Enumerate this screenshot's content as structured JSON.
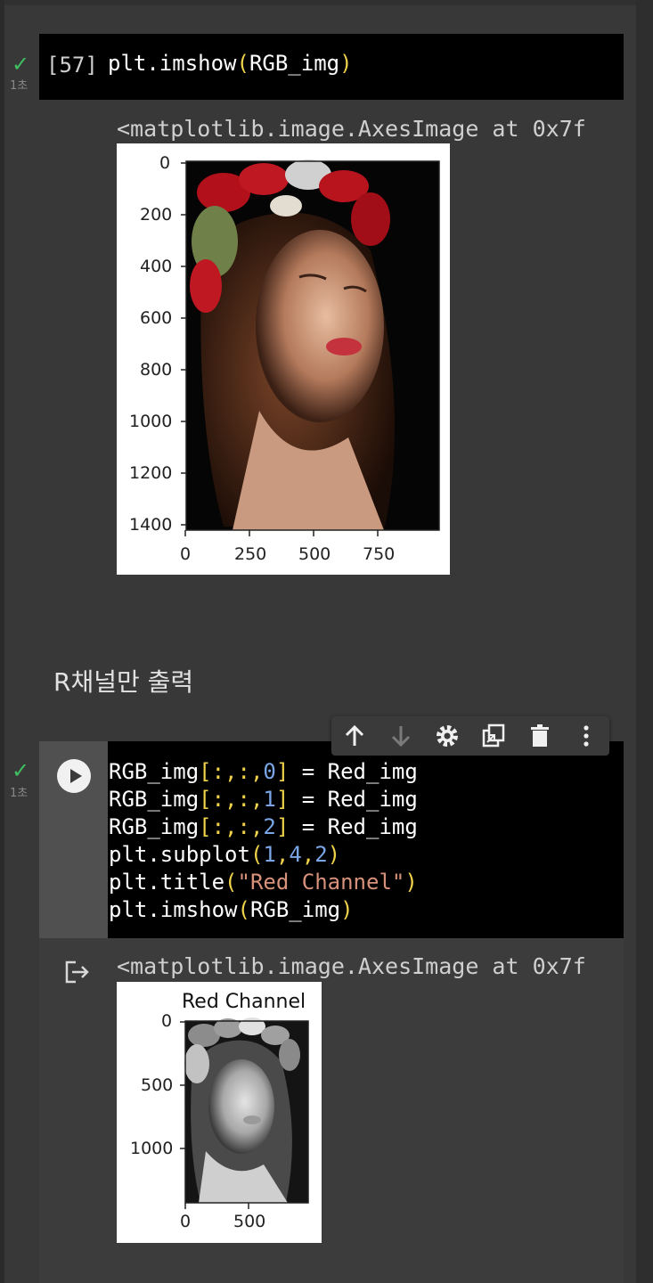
{
  "cell1": {
    "exec_count": "[57]",
    "status_time": "1초",
    "code": "plt.imshow(RGB_img)",
    "output_text": "<matplotlib.image.AxesImage at 0x7f",
    "plot": {
      "y_ticks": [
        "0",
        "200",
        "400",
        "600",
        "800",
        "1000",
        "1200",
        "1400"
      ],
      "x_ticks": [
        "0",
        "250",
        "500",
        "750"
      ]
    }
  },
  "markdown": {
    "text": "R채널만 출력"
  },
  "toolbar": {
    "icons": [
      "arrow-up-icon",
      "arrow-down-icon",
      "gear-icon",
      "mirror-cell-icon",
      "trash-icon",
      "more-vert-icon"
    ]
  },
  "cell2": {
    "status_time": "1초",
    "code_lines": [
      {
        "a": "RGB_img",
        "b": "[:,:,",
        "c": "0",
        "d": "]",
        "e": " = Red_img"
      },
      {
        "a": "RGB_img",
        "b": "[:,:,",
        "c": "1",
        "d": "]",
        "e": " = Red_img"
      },
      {
        "a": "RGB_img",
        "b": "[:,:,",
        "c": "2",
        "d": "]",
        "e": " = Red_img"
      }
    ],
    "line4": {
      "fn": "plt.subplot",
      "open": "(",
      "n1": "1",
      "c1": ",",
      "n2": "4",
      "c2": ",",
      "n3": "2",
      "close": ")"
    },
    "line5": {
      "fn": "plt.title",
      "open": "(",
      "str": "\"Red Channel\"",
      "close": ")"
    },
    "line6": {
      "fn": "plt.imshow",
      "open": "(",
      "arg": "RGB_img",
      "close": ")"
    },
    "output_text": "<matplotlib.image.AxesImage at 0x7f",
    "plot": {
      "title": "Red Channel",
      "y_ticks": [
        "0",
        "500",
        "1000"
      ],
      "x_ticks": [
        "0",
        "500"
      ]
    }
  },
  "colors": {
    "background": "#383838",
    "code_bg": "#000000",
    "check": "#3fbf60",
    "paren": "#f0d34a",
    "number": "#7aa6e8",
    "string": "#d8917a"
  }
}
